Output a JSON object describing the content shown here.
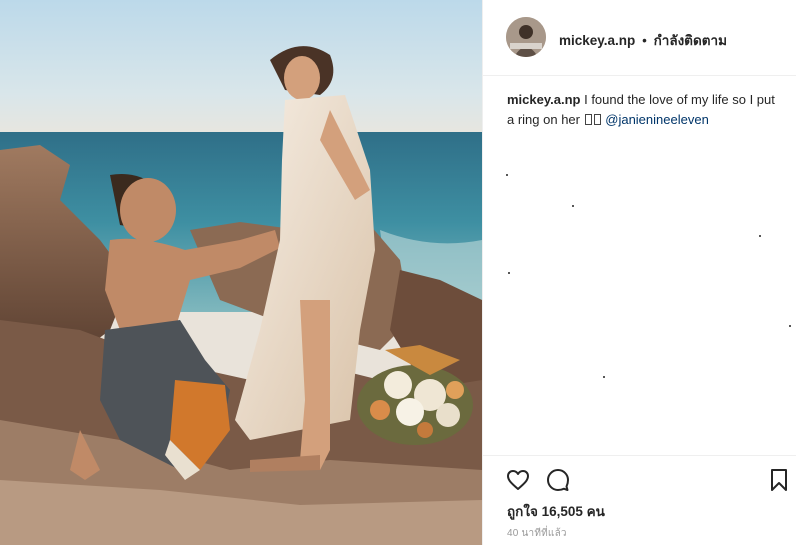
{
  "post": {
    "username": "mickey.a.np",
    "separator": "•",
    "follow_status": "กำลังติดตาม",
    "caption": {
      "username": "mickey.a.np",
      "text": "I found the love of my life so I put a ring on her",
      "mention": "@janienineeleven"
    },
    "likes": "ถูกใจ 16,505 คน",
    "timestamp": "40 นาทีที่แล้ว"
  },
  "icons": {
    "like": "heart-icon",
    "comment": "comment-icon",
    "save": "bookmark-icon"
  },
  "colors": {
    "text": "#262626",
    "mention": "#003569",
    "muted": "#999999",
    "divider": "#efefef"
  }
}
